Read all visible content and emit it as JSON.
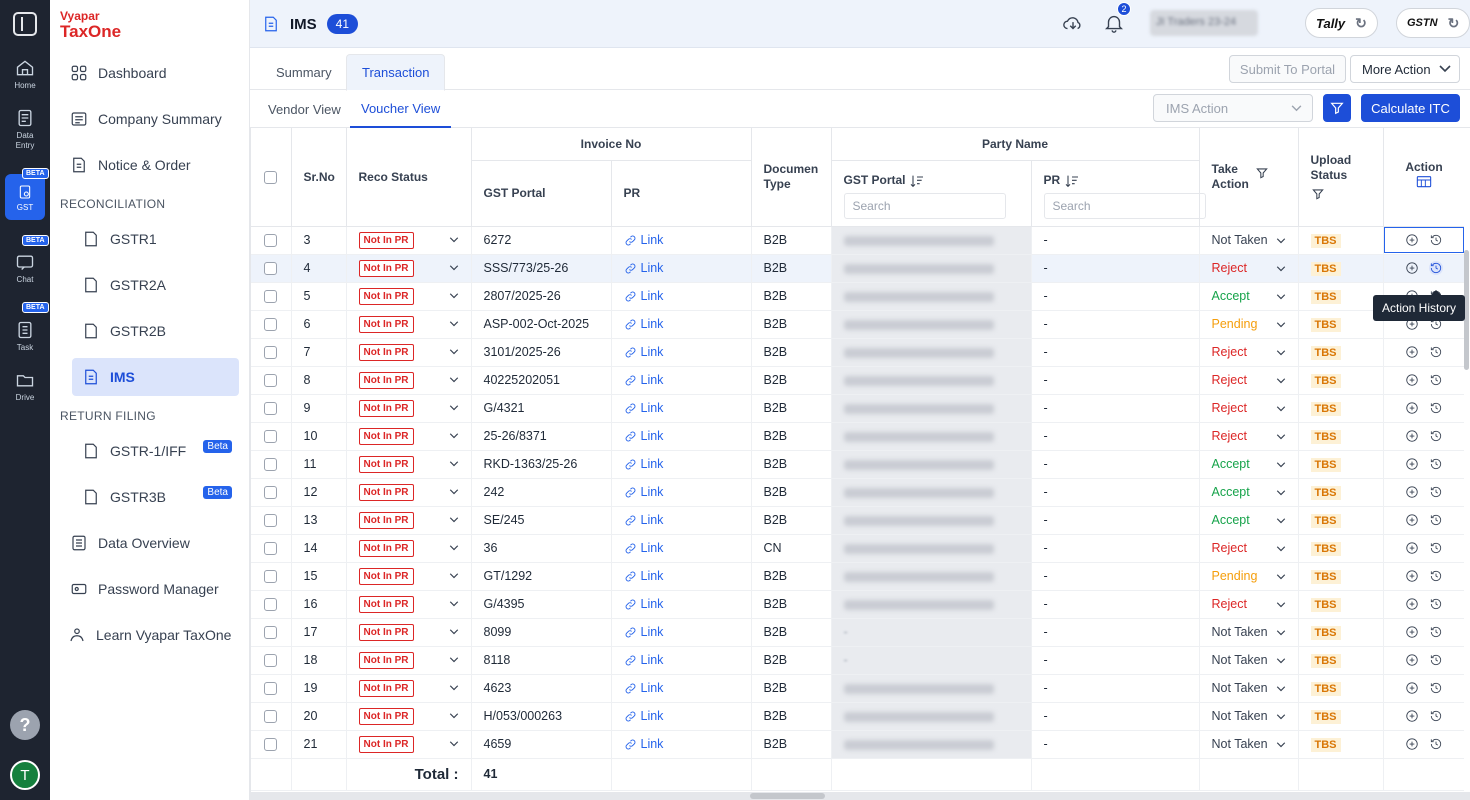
{
  "rail": {
    "items": [
      {
        "label": "Home",
        "icon": "home-icon"
      },
      {
        "label": "Data Entry",
        "icon": "data-entry-icon"
      },
      {
        "label": "GST",
        "icon": "gst-icon",
        "beta": "BETA"
      },
      {
        "label": "Chat",
        "icon": "chat-icon",
        "beta": "BETA"
      },
      {
        "label": "Task",
        "icon": "task-icon",
        "beta": "BETA"
      },
      {
        "label": "Drive",
        "icon": "drive-icon"
      }
    ],
    "help": "?",
    "avatar": "T"
  },
  "brand": {
    "line1": "Vyapar",
    "line2": "TaxOne"
  },
  "sidebar": {
    "top": [
      {
        "label": "Dashboard",
        "icon": "dashboard-icon"
      },
      {
        "label": "Company Summary",
        "icon": "company-summary-icon"
      },
      {
        "label": "Notice & Order",
        "icon": "notice-order-icon"
      }
    ],
    "reconciliation_title": "RECONCILIATION",
    "reconciliation": [
      {
        "label": "GSTR1",
        "icon": "gstr1-icon"
      },
      {
        "label": "GSTR2A",
        "icon": "gstr2a-icon"
      },
      {
        "label": "GSTR2B",
        "icon": "gstr2b-icon"
      },
      {
        "label": "IMS",
        "icon": "ims-icon"
      }
    ],
    "return_title": "RETURN FILING",
    "returns": [
      {
        "label": "GSTR-1/IFF",
        "badge": "Beta",
        "icon": "gstr1iff-icon"
      },
      {
        "label": "GSTR3B",
        "badge": "Beta",
        "icon": "gstr3b-icon"
      }
    ],
    "bottom": [
      {
        "label": "Data Overview",
        "icon": "data-overview-icon"
      },
      {
        "label": "Password Manager",
        "icon": "password-manager-icon"
      },
      {
        "label": "Learn Vyapar TaxOne",
        "icon": "learn-icon"
      }
    ]
  },
  "header": {
    "title": "IMS",
    "count": "41",
    "notification_count": "2",
    "company": "JI Traders 23-24",
    "tally_label": "Tally",
    "gstn_label": "GSTN"
  },
  "tabs": [
    "Summary",
    "Transaction"
  ],
  "actions": {
    "submit": "Submit To Portal",
    "more": "More Action",
    "ims_action": "IMS Action",
    "calculate": "Calculate ITC"
  },
  "views": [
    "Vendor View",
    "Voucher View"
  ],
  "table": {
    "headers": {
      "srno": "Sr.No",
      "reco": "Reco Status",
      "invoice": "Invoice No",
      "gst_portal": "GST Portal",
      "pr": "PR",
      "doc_type": "Documen Type",
      "party": "Party Name",
      "take_action": "Take Action",
      "upload": "Upload Status",
      "action": "Action",
      "search": "Search"
    },
    "rows": [
      {
        "sr": "3",
        "reco": "Not In PR",
        "inv": "6272",
        "pr": "Link",
        "doc": "B2B",
        "party": "SHYAM AGENCY",
        "party_pr": "-",
        "action": "Not Taken",
        "upload": "TBS"
      },
      {
        "sr": "4",
        "reco": "Not In PR",
        "inv": "SSS/773/25-26",
        "pr": "Link",
        "doc": "B2B",
        "party": "SHREE SHANKESHWAR SPICE",
        "party_pr": "-",
        "action": "Reject",
        "upload": "TBS"
      },
      {
        "sr": "5",
        "reco": "Not In PR",
        "inv": "2807/2025-26",
        "pr": "Link",
        "doc": "B2B",
        "party": "GANESH KIRANA CO",
        "party_pr": "-",
        "action": "Accept",
        "upload": "TBS"
      },
      {
        "sr": "6",
        "reco": "Not In PR",
        "inv": "ASP-002-Oct-2025",
        "pr": "Link",
        "doc": "B2B",
        "party": "ANITA SPICES LLP",
        "party_pr": "-",
        "action": "Pending",
        "upload": "TBS"
      },
      {
        "sr": "7",
        "reco": "Not In PR",
        "inv": "3101/2025-26",
        "pr": "Link",
        "doc": "B2B",
        "party": "AKASH TRADING CO",
        "party_pr": "-",
        "action": "Reject",
        "upload": "TBS"
      },
      {
        "sr": "8",
        "reco": "Not In PR",
        "inv": "40225202051",
        "pr": "Link",
        "doc": "B2B",
        "party": "DM LOGISTICS SUPPLY CHAIN",
        "party_pr": "-",
        "action": "Reject",
        "upload": "TBS"
      },
      {
        "sr": "9",
        "reco": "Not In PR",
        "inv": "G/4321",
        "pr": "Link",
        "doc": "B2B",
        "party": "SAVITRI GENERAL",
        "party_pr": "-",
        "action": "Reject",
        "upload": "TBS"
      },
      {
        "sr": "10",
        "reco": "Not In PR",
        "inv": "25-26/8371",
        "pr": "Link",
        "doc": "B2B",
        "party": "PATEL GHANSHYAMKUMAR M",
        "party_pr": "-",
        "action": "Reject",
        "upload": "TBS"
      },
      {
        "sr": "11",
        "reco": "Not In PR",
        "inv": "RKD-1363/25-26",
        "pr": "Link",
        "doc": "B2B",
        "party": "R K DRYFRUITS",
        "party_pr": "-",
        "action": "Accept",
        "upload": "TBS"
      },
      {
        "sr": "12",
        "reco": "Not In PR",
        "inv": "242",
        "pr": "Link",
        "doc": "B2B",
        "party": "SHREE GANESH TRADERS",
        "party_pr": "-",
        "action": "Accept",
        "upload": "TBS"
      },
      {
        "sr": "13",
        "reco": "Not In PR",
        "inv": "SE/245",
        "pr": "Link",
        "doc": "B2B",
        "party": "SACCHA SAUDA TRADERS",
        "party_pr": "-",
        "action": "Accept",
        "upload": "TBS"
      },
      {
        "sr": "14",
        "reco": "Not In PR",
        "inv": "36",
        "pr": "Link",
        "doc": "CN",
        "party": "VIMAL TRADERS",
        "party_pr": "-",
        "action": "Reject",
        "upload": "TBS"
      },
      {
        "sr": "15",
        "reco": "Not In PR",
        "inv": "GT/1292",
        "pr": "Link",
        "doc": "B2B",
        "party": "SHREE SHAKTI TRADING CO",
        "party_pr": "-",
        "action": "Pending",
        "upload": "TBS"
      },
      {
        "sr": "16",
        "reco": "Not In PR",
        "inv": "G/4395",
        "pr": "Link",
        "doc": "B2B",
        "party": "SAVITRI GENERAL",
        "party_pr": "-",
        "action": "Reject",
        "upload": "TBS"
      },
      {
        "sr": "17",
        "reco": "Not In PR",
        "inv": "8099",
        "pr": "Link",
        "doc": "B2B",
        "party": "-",
        "party_pr": "-",
        "action": "Not Taken",
        "upload": "TBS"
      },
      {
        "sr": "18",
        "reco": "Not In PR",
        "inv": "8118",
        "pr": "Link",
        "doc": "B2B",
        "party": "-",
        "party_pr": "-",
        "action": "Not Taken",
        "upload": "TBS"
      },
      {
        "sr": "19",
        "reco": "Not In PR",
        "inv": "4623",
        "pr": "Link",
        "doc": "B2B",
        "party": "DIPAK KIRVANA STORES",
        "party_pr": "-",
        "action": "Not Taken",
        "upload": "TBS"
      },
      {
        "sr": "20",
        "reco": "Not In PR",
        "inv": "H/053/000263",
        "pr": "Link",
        "doc": "B2B",
        "party": "PATEL ISHWARLAL JOTHARAM",
        "party_pr": "-",
        "action": "Not Taken",
        "upload": "TBS"
      },
      {
        "sr": "21",
        "reco": "Not In PR",
        "inv": "4659",
        "pr": "Link",
        "doc": "B2B",
        "party": "DIPAK KIRVANA STORES",
        "party_pr": "-",
        "action": "Not Taken",
        "upload": "TBS"
      }
    ],
    "total_label": "Total :",
    "total_value": "41"
  },
  "tooltip": "Action History",
  "colors": {
    "accent": "#1d4ed8",
    "reject": "#dc2626",
    "accept": "#16a34a",
    "pending": "#f59e0b",
    "not_taken": "#374151"
  }
}
